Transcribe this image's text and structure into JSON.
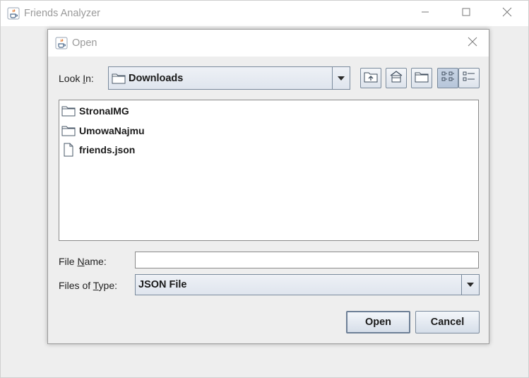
{
  "window": {
    "title": "Friends Analyzer"
  },
  "dialog": {
    "title": "Open",
    "look_in_label_pre": "Look ",
    "look_in_label_mnemonic": "I",
    "look_in_label_post": "n:",
    "look_in_value": "Downloads",
    "toolbar": {
      "up_one_level": "up-folder-icon",
      "home": "home-icon",
      "new_folder": "new-folder-icon",
      "list_view": "list-view-icon",
      "details_view": "details-view-icon"
    },
    "files": [
      {
        "name": "StronaIMG",
        "type": "folder"
      },
      {
        "name": "UmowaNajmu",
        "type": "folder"
      },
      {
        "name": "friends.json",
        "type": "file"
      }
    ],
    "file_name_label_pre": "File ",
    "file_name_label_mnemonic": "N",
    "file_name_label_post": "ame:",
    "file_name_value": "",
    "files_of_type_label_pre": "Files of ",
    "files_of_type_label_mnemonic": "T",
    "files_of_type_label_post": "ype:",
    "files_of_type_value": "JSON File",
    "open_button": "Open",
    "cancel_button": "Cancel"
  }
}
